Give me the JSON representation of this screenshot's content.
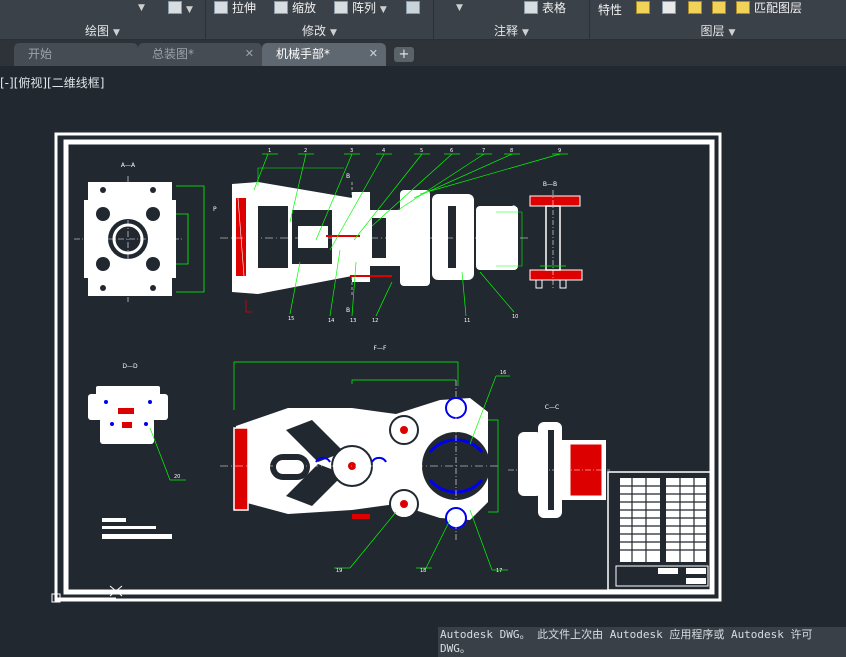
{
  "ribbon": {
    "groups": [
      {
        "title": "绘图"
      },
      {
        "title": "修改"
      },
      {
        "title": "注释"
      },
      {
        "title": "图层"
      }
    ],
    "buttons": {
      "stretch": "拉伸",
      "scale": "缩放",
      "array": "阵列",
      "table": "表格",
      "properties": "特性",
      "match_layer": "匹配图层"
    }
  },
  "tabs": [
    {
      "label": "开始"
    },
    {
      "label": "总装图*"
    },
    {
      "label": "机械手部*"
    }
  ],
  "viewport_label": "[-][俯视][二维线框]",
  "drawing": {
    "views": {
      "a": "A—A",
      "b": "B—B",
      "d": "D—D",
      "c": "C—C",
      "f": "F—F"
    },
    "balloons": [
      "1",
      "2",
      "3",
      "4",
      "5",
      "6",
      "7",
      "8",
      "9",
      "10",
      "11",
      "12",
      "13",
      "14",
      "15",
      "16",
      "17",
      "18",
      "19",
      "20"
    ],
    "dim_p": "P",
    "dim_b": "B"
  },
  "command_line": {
    "line1": "Autodesk DWG。  此文件上次由 Autodesk 应用程序或 Autodesk 许可",
    "line2": "DWG。"
  }
}
